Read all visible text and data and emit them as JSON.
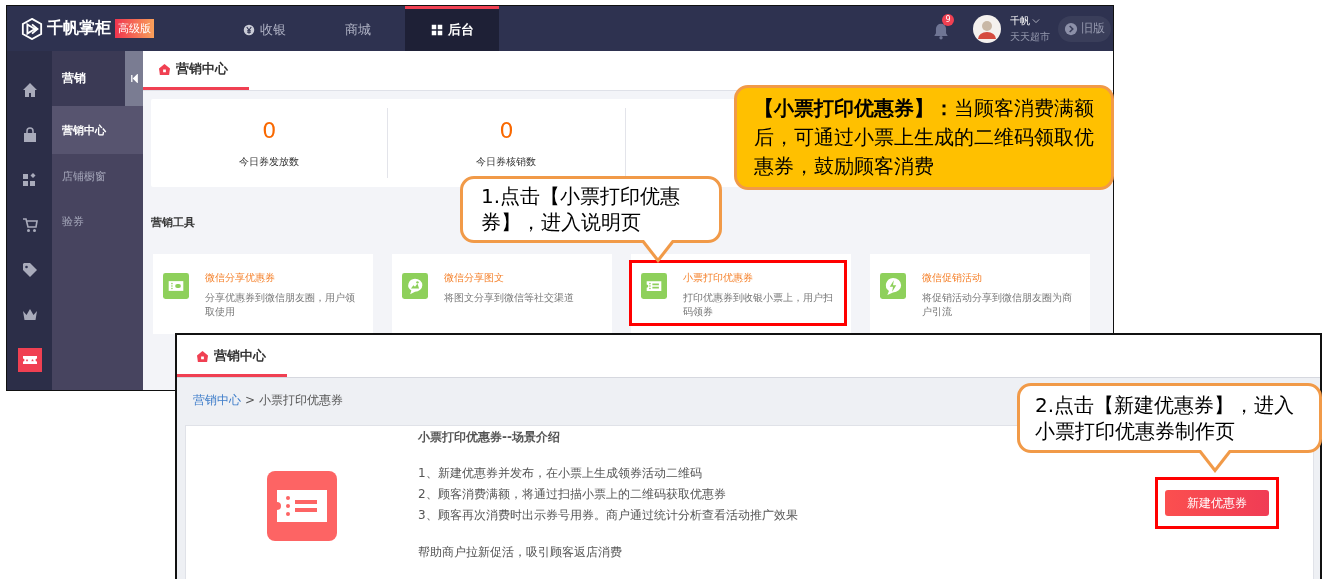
{
  "main_window": {
    "logo": {
      "name": "千帆掌柜",
      "badge": "高级版"
    },
    "nav": [
      {
        "label": "收银",
        "selected": false
      },
      {
        "label": "商城",
        "selected": false
      },
      {
        "label": "后台",
        "selected": true
      }
    ],
    "notifications": {
      "count": "9"
    },
    "user": {
      "name": "千帆",
      "store": "天天超市"
    },
    "old_version_button": "旧版",
    "icon_rail": [
      {
        "selected": false
      },
      {
        "selected": false
      },
      {
        "selected": false
      },
      {
        "selected": false
      },
      {
        "selected": false
      },
      {
        "selected": false
      },
      {
        "selected": true
      }
    ],
    "submenu": {
      "title": "营销",
      "items": [
        {
          "label": "营销中心",
          "selected": true
        },
        {
          "label": "店铺橱窗",
          "selected": false
        },
        {
          "label": "验券",
          "selected": false
        }
      ]
    },
    "page_tab": "营销中心",
    "stats": [
      {
        "value": "0",
        "label": "今日券发放数"
      },
      {
        "value": "0",
        "label": "今日券核销数"
      }
    ],
    "tools_heading": "营销工具",
    "tools": [
      {
        "title": "微信分享优惠券",
        "description": "分享优惠券到微信朋友圈，用户领取使用",
        "highlighted": false
      },
      {
        "title": "微信分享图文",
        "description": "将图文分享到微信等社交渠道",
        "highlighted": false
      },
      {
        "title": "小票打印优惠券",
        "description": "打印优惠券到收银小票上，用户扫码领券",
        "highlighted": true
      },
      {
        "title": "微信促销活动",
        "description": "将促销活动分享到微信朋友圈为商户引流",
        "highlighted": false
      }
    ]
  },
  "detail_window": {
    "page_tab": "营销中心",
    "breadcrumb": [
      {
        "label": "营销中心",
        "kind": "link"
      },
      {
        "label": ">",
        "kind": "separator"
      },
      {
        "label": "小票打印优惠券",
        "kind": "current"
      }
    ],
    "intro": {
      "title": "小票打印优惠券--场景介绍",
      "lines": [
        "1、新建优惠券并发布，在小票上生成领券活动二维码",
        "2、顾客消费满额，将通过扫描小票上的二维码获取优惠券",
        "3、顾客再次消费时出示券号用券。商户通过统计分析查看活动推广效果"
      ],
      "footer": "帮助商户拉新促活，吸引顾客返店消费"
    },
    "button": {
      "label": "新建优惠券",
      "highlighted": true
    }
  },
  "callouts": [
    {
      "kind": "step",
      "text": "1.点击【小票打印优惠券】，进入说明页"
    },
    {
      "kind": "definition",
      "text": "**【小票打印优惠券】：**当顾客消费满额后，可通过小票上生成的二维码领取优惠券，鼓励顾客消费"
    },
    {
      "kind": "step",
      "text": "2.点击【新建优惠券】，进入小票打印优惠券制作页"
    }
  ]
}
